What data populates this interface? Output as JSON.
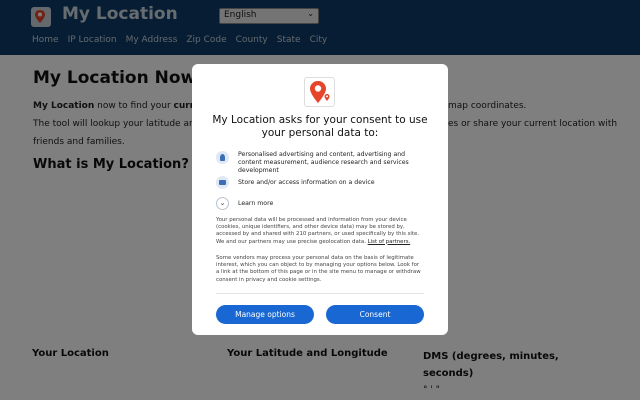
{
  "site": {
    "title": "My Location",
    "language": "English",
    "nav": [
      "Home",
      "IP Location",
      "My Address",
      "Zip Code",
      "County",
      "State",
      "City"
    ]
  },
  "content": {
    "heading": "My Location Now",
    "p1_bold": "My Location",
    "p1_text": " now to find your ",
    "p1_bold2": "current",
    "p1_right": "map coordinates.",
    "p2_left": "The tool will lookup your latitude and lo",
    "p2_right": "es or share your current location with",
    "p3": "friends and families.",
    "subheading": "What is My Location?",
    "col1": "Your Location",
    "col2": "Your Latitude and Longitude",
    "col3": "DMS (degrees, minutes, seconds)",
    "dms_value": "° ' \""
  },
  "modal": {
    "title": "My Location asks for your consent to use your personal data to:",
    "purposes": [
      "Personalised advertising and content, advertising and content measurement, audience research and services development",
      "Store and/or access information on a device"
    ],
    "learn_more": "Learn more",
    "body1": "Your personal data will be processed and information from your device (cookies, unique identifiers, and other device data) may be stored by, accessed by and shared with 210 partners, or used specifically by this site. We and our partners may use precise geolocation data.",
    "body1_link": "List of partners.",
    "body2": "Some vendors may process your personal data on the basis of legitimate interest, which you can object to by managing your options below. Look for a link at the bottom of this page or in the site menu to manage or withdraw consent in privacy and cookie settings.",
    "manage_label": "Manage options",
    "consent_label": "Consent"
  },
  "colors": {
    "header_bg": "#0d3b66",
    "accent": "#1967d2",
    "pin_red": "#e5452b"
  }
}
